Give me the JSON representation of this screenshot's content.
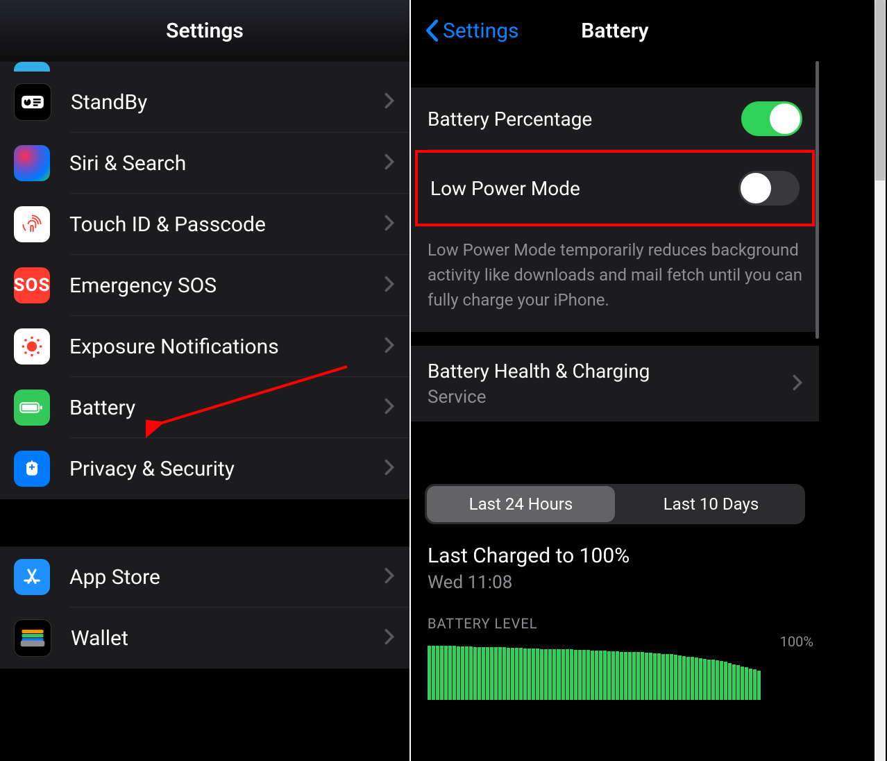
{
  "left": {
    "title": "Settings",
    "items": [
      {
        "label": "StandBy"
      },
      {
        "label": "Siri & Search"
      },
      {
        "label": "Touch ID & Passcode"
      },
      {
        "label": "Emergency SOS"
      },
      {
        "label": "Exposure Notifications"
      },
      {
        "label": "Battery"
      },
      {
        "label": "Privacy & Security"
      }
    ],
    "items2": [
      {
        "label": "App Store"
      },
      {
        "label": "Wallet"
      }
    ]
  },
  "right": {
    "back": "Settings",
    "title": "Battery",
    "percentage_label": "Battery Percentage",
    "lpm_label": "Low Power Mode",
    "lpm_desc": "Low Power Mode temporarily reduces background activity like downloads and mail fetch until you can fully charge your iPhone.",
    "health_label": "Battery Health & Charging",
    "health_sub": "Service",
    "seg_a": "Last 24 Hours",
    "seg_b": "Last 10 Days",
    "charged_title": "Last Charged to 100%",
    "charged_sub": "Wed 11:08",
    "bl_label": "BATTERY LEVEL",
    "y100": "100%"
  },
  "chart_data": {
    "type": "bar",
    "title": "BATTERY LEVEL",
    "ylabel": "",
    "ylim": [
      0,
      100
    ],
    "categories_note": "hourly samples over last 24 hours",
    "values": [
      100,
      100,
      100,
      100,
      100,
      100,
      100,
      99,
      99,
      99,
      99,
      98,
      98,
      98,
      98,
      97,
      97,
      97,
      97,
      96,
      96,
      96,
      96,
      95,
      95,
      95,
      95,
      94,
      94,
      94,
      94,
      93,
      93,
      93,
      93,
      92,
      92,
      92,
      92,
      91,
      91,
      91,
      91,
      90,
      90,
      90,
      89,
      89,
      89,
      88,
      88,
      88,
      87,
      87,
      86,
      86,
      85,
      85,
      84,
      83,
      82,
      81,
      80,
      79,
      78,
      77,
      76,
      75,
      74,
      73,
      72,
      70,
      68,
      66,
      64,
      62,
      60,
      58,
      56,
      54
    ]
  }
}
